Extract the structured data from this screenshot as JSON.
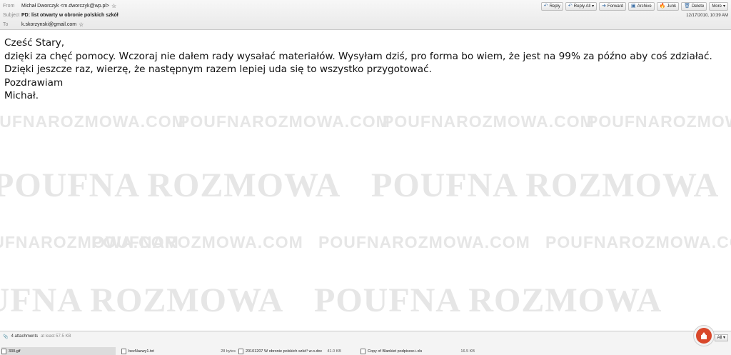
{
  "header": {
    "from_label": "From",
    "from_value": "Michał Dworczyk <m.dworczyk@wp.pl>",
    "subject_label": "Subject",
    "subject_value": "PD: list otwarty w obronie polskich szkół",
    "to_label": "To",
    "to_value": "k.skorzynski@gmail.com",
    "date": "12/17/2010, 10:39 AM"
  },
  "toolbar": {
    "reply": "Reply",
    "reply_all": "Reply All",
    "forward": "Forward",
    "archive": "Archive",
    "junk": "Junk",
    "delete": "Delete",
    "more": "More"
  },
  "message": {
    "lines": [
      "Cześć Stary,",
      "dzięki za chęć pomocy. Wczoraj nie dałem rady wysałać materiałów. Wysyłam dziś, pro forma bo wiem, że jest na 99% za późno aby coś zdziałać. Dzięki jeszcze raz, wierzę, że następnym razem lepiej uda się to wszystko przygotować.",
      "Pozdrawiam",
      "Michał."
    ]
  },
  "watermark": {
    "small": "POUFNAROZMOWA.COM",
    "big": "POUFNA ROZMOWA"
  },
  "attachments": {
    "count_label": "4 attachments",
    "total_size": "at least 57.5 KB",
    "all_label": "All",
    "items": [
      {
        "name": "330.gif",
        "size": ""
      },
      {
        "name": "bezNazwy1.txt",
        "size": "28 bytes"
      },
      {
        "name": "20101207 W obronie polskich szkó³ w.o.doc",
        "size": "41.0 KB"
      },
      {
        "name": "Copy of Blankiet podpisow+.xls",
        "size": "16.5 KB"
      }
    ]
  },
  "colors": {
    "accent": "#3a6ea5",
    "fab": "#d9482b",
    "watermark": "#e6e6e6"
  }
}
